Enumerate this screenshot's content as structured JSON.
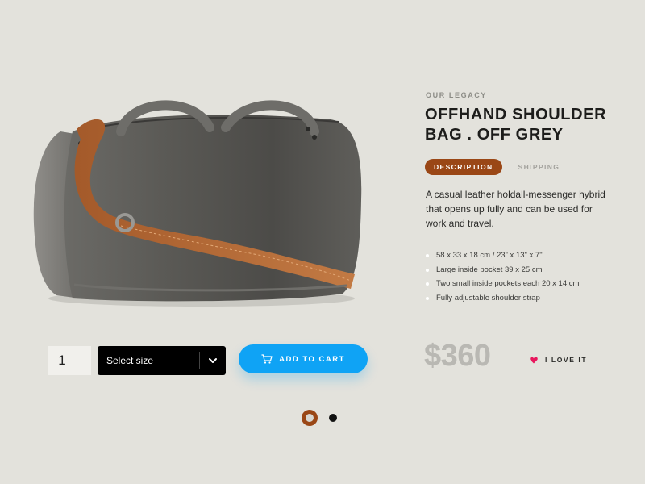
{
  "product": {
    "brand": "OUR LEGACY",
    "title_line1": "OFFHAND SHOULDER",
    "title_line2": "BAG . OFF GREY",
    "description": "A casual leather holdall-messenger hybrid that opens up fully and can be used for work and travel.",
    "price": "$360"
  },
  "tabs": [
    {
      "label": "DESCRIPTION",
      "active": true
    },
    {
      "label": "SHIPPING",
      "active": false
    }
  ],
  "specs": [
    "58 x 33 x 18 cm / 23\" x 13\" x 7\"",
    "Large inside pocket 39 x 25 cm",
    "Two small inside pockets each 20 x 14 cm",
    "Fully adjustable shoulder strap"
  ],
  "purchase": {
    "quantity": "1",
    "size_placeholder": "Select size",
    "add_to_cart_label": "ADD TO CART"
  },
  "love": {
    "label": "I LOVE IT"
  },
  "carousel": {
    "current": 1,
    "total": 2
  },
  "colors": {
    "background": "#e3e2dc",
    "accent_brown": "#9a4716",
    "cart_blue": "#0fa3f5",
    "heart_pink": "#e8175d"
  },
  "icons": [
    "bag-product-image",
    "chevron-up-icon",
    "chevron-down-icon",
    "cart-icon",
    "heart-icon"
  ]
}
